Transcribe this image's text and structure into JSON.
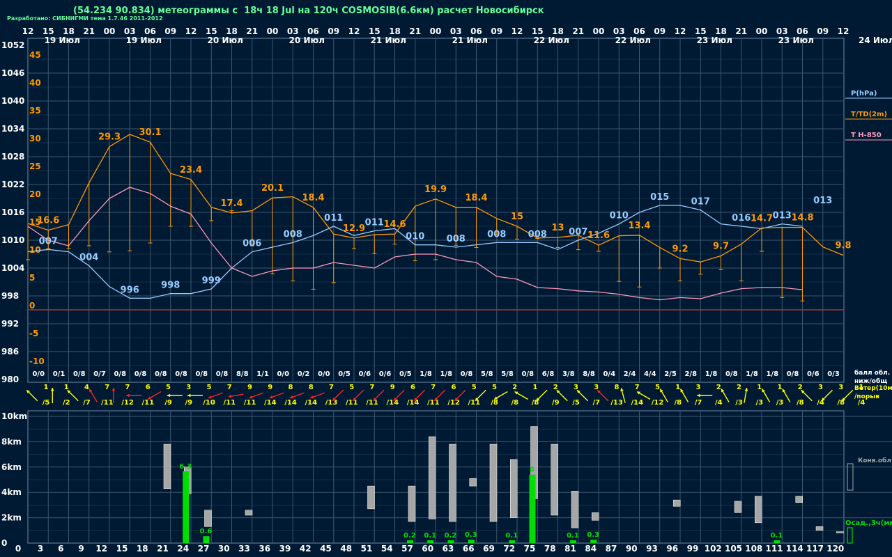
{
  "header": {
    "title": "(54.234 90.834) метеограммы с  18ч 18 Jul на 120ч COSMOSIB(6.6км) расчет Новосибирск",
    "developer": "Разработано: СИБНИГМИ тема 1.7.46 2011-2012"
  },
  "colors": {
    "background": "#001a33",
    "grid": "#3d5770",
    "pressure": "#99ccff",
    "temperature": "#ff9900",
    "t850": "#ff99bb",
    "zero_line": "#aa3333",
    "precip": "#00dd00",
    "convective_cloud": "#a6a6a6",
    "wind_calm": "#ffff00",
    "wind_strong": "#ff2222"
  },
  "time_axis": {
    "hours": [
      "12",
      "15",
      "18",
      "21",
      "00",
      "03",
      "06",
      "09",
      "12",
      "15",
      "18",
      "21",
      "00",
      "03",
      "06",
      "09",
      "12",
      "15",
      "18",
      "21",
      "00",
      "03",
      "06",
      "09",
      "12",
      "15",
      "18",
      "21",
      "00",
      "03",
      "06",
      "09",
      "12",
      "15",
      "18",
      "21",
      "00",
      "03",
      "06",
      "09",
      "12"
    ],
    "dates": [
      {
        "label": "19 Июл",
        "i": 1
      },
      {
        "label": "19 Июл",
        "i": 5
      },
      {
        "label": "20 Июл",
        "i": 9
      },
      {
        "label": "20 Июл",
        "i": 13
      },
      {
        "label": "21 Июл",
        "i": 17
      },
      {
        "label": "21 Июл",
        "i": 21
      },
      {
        "label": "22 Июл",
        "i": 25
      },
      {
        "label": "22 Июл",
        "i": 29
      },
      {
        "label": "23 Июл",
        "i": 33
      },
      {
        "label": "23 Июл",
        "i": 37
      }
    ],
    "right_date": "24 Июл",
    "lead_hours": [
      "3",
      "6",
      "9",
      "12",
      "15",
      "18",
      "21",
      "24",
      "27",
      "30",
      "33",
      "36",
      "39",
      "42",
      "45",
      "48",
      "51",
      "54",
      "57",
      "60",
      "63",
      "66",
      "69",
      "72",
      "75",
      "78",
      "81",
      "84",
      "87",
      "90",
      "93",
      "96",
      "99",
      "102",
      "105",
      "108",
      "111",
      "114",
      "117",
      "120"
    ],
    "lead_zero": "0"
  },
  "legend": {
    "pressure": "P(hPa)",
    "temperature": "T/TD(2m)",
    "t850": "T H-850",
    "cloud_label": "балл обл.",
    "cloud_sublabel": "ниж/общ",
    "wind_label": "Ветер(10м)",
    "wind_sublabel": "/порыв",
    "conv_label": "Конв.обл.",
    "precip_label": "Осад.,3ч(мм)"
  },
  "chart_data": {
    "type": "line",
    "pressure_axis": {
      "ticks": [
        "1052",
        "1046",
        "1040",
        "1034",
        "1028",
        "1022",
        "1016",
        "1010",
        "1004",
        "998",
        "992",
        "986",
        "980"
      ],
      "range": [
        980,
        1052
      ]
    },
    "temperature_axis": {
      "ticks": [
        "45",
        "40",
        "35",
        "30",
        "25",
        "20",
        "15",
        "10",
        "5",
        "0",
        "-5",
        "-10"
      ],
      "range": [
        -10,
        45
      ]
    },
    "series": [
      {
        "name": "P(hPa)",
        "values": [
          1007.5,
          1008,
          1007.5,
          1004.5,
          1000,
          997.5,
          997.5,
          998.5,
          998.5,
          999.5,
          1004,
          1007.5,
          1008.5,
          1009.5,
          1011,
          1013,
          1011,
          1012,
          1012.5,
          1009,
          1009,
          1008.5,
          1009,
          1009.5,
          1009.5,
          1009.5,
          1008,
          1010,
          1011.5,
          1013.5,
          1016,
          1017.5,
          1017.5,
          1016.5,
          1013.5,
          1013,
          1012.5,
          1013.5,
          1013
        ]
      },
      {
        "name": "T/TD(2m)",
        "values": [
          15.5,
          14.3,
          15.3,
          22.8,
          29.3,
          31.5,
          30.1,
          24.5,
          23.4,
          18.4,
          17.4,
          17.8,
          20.1,
          20.3,
          18.4,
          13.6,
          12.9,
          13.5,
          13.6,
          18.6,
          19.9,
          18.4,
          18.4,
          16.4,
          15,
          12.9,
          13,
          13.4,
          11.6,
          13.3,
          13.4,
          11.2,
          9.2,
          8.6,
          9.7,
          11.8,
          14.7,
          14.8,
          14.8,
          11.3,
          9.8
        ]
      },
      {
        "name": "TD",
        "values": [
          9,
          11,
          11,
          11.5,
          10.4,
          10.6,
          12,
          15,
          15,
          16,
          17.8,
          11.5,
          6.5,
          5.2,
          3.7,
          4.9,
          11,
          10.1,
          11.8,
          8.8,
          9,
          11.6,
          11.2,
          13.5,
          12.7,
          12.8,
          11.2,
          10.8,
          10.5,
          5.1,
          4.1,
          7.5,
          5.2,
          6.4,
          7.2,
          5.2,
          10.5,
          2.2,
          1.6
        ]
      },
      {
        "name": "T H-850",
        "values": [
          15,
          12.5,
          11.5,
          16,
          20,
          22,
          20.9,
          18.6,
          17.2,
          12,
          7.5,
          6,
          7,
          7.5,
          7.5,
          8.5,
          8,
          7.5,
          9.5,
          10,
          10,
          9,
          8.5,
          6,
          5.5,
          4,
          3.8,
          3.4,
          3.2,
          2.8,
          2.2,
          1.8,
          2.2,
          2,
          3,
          3.8,
          4,
          4,
          3.6
        ]
      }
    ],
    "temperature_labels": [
      {
        "i": 1,
        "v": "16.6"
      },
      {
        "i": 4,
        "v": "29.3"
      },
      {
        "i": 6,
        "v": "30.1"
      },
      {
        "i": 8,
        "v": "23.4"
      },
      {
        "i": 10,
        "v": "17.4"
      },
      {
        "i": 12,
        "v": "20.1"
      },
      {
        "i": 14,
        "v": "18.4"
      },
      {
        "i": 16,
        "v": "12.9"
      },
      {
        "i": 18,
        "v": "14.6"
      },
      {
        "i": 20,
        "v": "19.9"
      },
      {
        "i": 22,
        "v": "18.4"
      },
      {
        "i": 24,
        "v": "15"
      },
      {
        "i": 26,
        "v": "13"
      },
      {
        "i": 28,
        "v": "11.6"
      },
      {
        "i": 30,
        "v": "13.4"
      },
      {
        "i": 32,
        "v": "9.2"
      },
      {
        "i": 34,
        "v": "9.7"
      },
      {
        "i": 36,
        "v": "14.7"
      },
      {
        "i": 38,
        "v": "14.8"
      },
      {
        "i": 40,
        "v": "9.8"
      }
    ],
    "pressure_labels": [
      {
        "i": 1,
        "v": "007"
      },
      {
        "i": 3,
        "v": "004"
      },
      {
        "i": 5,
        "v": "996"
      },
      {
        "i": 7,
        "v": "998"
      },
      {
        "i": 9,
        "v": "999"
      },
      {
        "i": 11,
        "v": "006"
      },
      {
        "i": 13,
        "v": "008"
      },
      {
        "i": 15,
        "v": "011"
      },
      {
        "i": 17,
        "v": "011"
      },
      {
        "i": 19,
        "v": "010"
      },
      {
        "i": 21,
        "v": "008"
      },
      {
        "i": 23,
        "v": "008"
      },
      {
        "i": 25,
        "v": "008"
      },
      {
        "i": 27,
        "v": "007"
      },
      {
        "i": 29,
        "v": "010"
      },
      {
        "i": 31,
        "v": "015"
      },
      {
        "i": 33,
        "v": "017"
      },
      {
        "i": 35,
        "v": "016"
      },
      {
        "i": 37,
        "v": "013"
      },
      {
        "i": 39,
        "v": "013"
      }
    ],
    "cloud_cover": [
      "0/0",
      "0/1",
      "0/8",
      "0/7",
      "0/8",
      "0/8",
      "0/8",
      "0/8",
      "0/8",
      "0/8",
      "8/8",
      "1/1",
      "0/0",
      "0/2",
      "0/0",
      "0/5",
      "0/6",
      "0/6",
      "0/5",
      "1/8",
      "1/8",
      "0/8",
      "5/8",
      "5/8",
      "0/8",
      "6/8",
      "3/8",
      "8/8",
      "0/4",
      "2/4",
      "4/4",
      "2/5",
      "2/8",
      "1/8",
      "0/8",
      "1/8",
      "1/8",
      "0/8",
      "0/6",
      "0/3"
    ],
    "wind": [
      {
        "s": "1",
        "g": "/5",
        "dir": 315,
        "strong": false
      },
      {
        "s": "1",
        "g": "/2",
        "dir": 0,
        "strong": false
      },
      {
        "s": "4",
        "g": "/7",
        "dir": 315,
        "strong": false
      },
      {
        "s": "7",
        "g": "/11",
        "dir": 330,
        "strong": true
      },
      {
        "s": "7",
        "g": "/12",
        "dir": 0,
        "strong": true
      },
      {
        "s": "6",
        "g": "/11",
        "dir": 270,
        "strong": true
      },
      {
        "s": "5",
        "g": "/9",
        "dir": 240,
        "strong": true
      },
      {
        "s": "3",
        "g": "/9",
        "dir": 270,
        "strong": false
      },
      {
        "s": "5",
        "g": "/10",
        "dir": 270,
        "strong": false
      },
      {
        "s": "7",
        "g": "/11",
        "dir": 250,
        "strong": true
      },
      {
        "s": "9",
        "g": "/11",
        "dir": 260,
        "strong": true
      },
      {
        "s": "9",
        "g": "/14",
        "dir": 250,
        "strong": true
      },
      {
        "s": "8",
        "g": "/14",
        "dir": 250,
        "strong": true
      },
      {
        "s": "8",
        "g": "/14",
        "dir": 250,
        "strong": true
      },
      {
        "s": "7",
        "g": "/13",
        "dir": 250,
        "strong": true
      },
      {
        "s": "5",
        "g": "/11",
        "dir": 225,
        "strong": true
      },
      {
        "s": "7",
        "g": "/11",
        "dir": 225,
        "strong": true
      },
      {
        "s": "9",
        "g": "/14",
        "dir": 225,
        "strong": true
      },
      {
        "s": "6",
        "g": "/14",
        "dir": 225,
        "strong": true
      },
      {
        "s": "7",
        "g": "/11",
        "dir": 225,
        "strong": true
      },
      {
        "s": "6",
        "g": "/12",
        "dir": 225,
        "strong": true
      },
      {
        "s": "5",
        "g": "/11",
        "dir": 225,
        "strong": true
      },
      {
        "s": "5",
        "g": "/8",
        "dir": 225,
        "strong": false
      },
      {
        "s": "2",
        "g": "/8",
        "dir": 240,
        "strong": false
      },
      {
        "s": "1",
        "g": "/8",
        "dir": 300,
        "strong": false
      },
      {
        "s": "2",
        "g": "/9",
        "dir": 225,
        "strong": false
      },
      {
        "s": "3",
        "g": "/5",
        "dir": 315,
        "strong": false
      },
      {
        "s": "3",
        "g": "/7",
        "dir": 315,
        "strong": false
      },
      {
        "s": "8",
        "g": "/13",
        "dir": 315,
        "strong": true
      },
      {
        "s": "7",
        "g": "/14",
        "dir": 345,
        "strong": false
      },
      {
        "s": "5",
        "g": "/12",
        "dir": 300,
        "strong": false
      },
      {
        "s": "1",
        "g": "/8",
        "dir": 330,
        "strong": false
      },
      {
        "s": "3",
        "g": "/7",
        "dir": 330,
        "strong": false
      },
      {
        "s": "2",
        "g": "/4",
        "dir": 270,
        "strong": false
      },
      {
        "s": "2",
        "g": "/3",
        "dir": 330,
        "strong": false
      },
      {
        "s": "1",
        "g": "/3",
        "dir": 10,
        "strong": false
      },
      {
        "s": "1",
        "g": "/3",
        "dir": 330,
        "strong": false
      },
      {
        "s": "2",
        "g": "/8",
        "dir": 330,
        "strong": false
      },
      {
        "s": "3",
        "g": "/4",
        "dir": 315,
        "strong": false
      },
      {
        "s": "3",
        "g": "/8",
        "dir": 225,
        "strong": false
      },
      {
        "s": "1",
        "g": "/4",
        "dir": 225,
        "strong": false
      }
    ],
    "height_axis": {
      "ticks": [
        "10km",
        "8km",
        "6km",
        "4km",
        "2km",
        "0"
      ],
      "range": [
        0,
        10
      ]
    },
    "convective_clouds": [
      {
        "i": 8,
        "bottom": 4.3,
        "top": 7.8
      },
      {
        "i": 9,
        "bottom": 3.9,
        "top": 6
      },
      {
        "i": 10,
        "bottom": 1.3,
        "top": 2.6
      },
      {
        "i": 12,
        "bottom": 2.2,
        "top": 2.6
      },
      {
        "i": 18,
        "bottom": 2.7,
        "top": 4.5
      },
      {
        "i": 20,
        "bottom": 1.7,
        "top": 4.5
      },
      {
        "i": 21,
        "bottom": 1.9,
        "top": 8.4
      },
      {
        "i": 22,
        "bottom": 1.7,
        "top": 7.8
      },
      {
        "i": 23,
        "bottom": 4.5,
        "top": 5.1
      },
      {
        "i": 24,
        "bottom": 1.7,
        "top": 7.8
      },
      {
        "i": 25,
        "bottom": 2,
        "top": 6.6
      },
      {
        "i": 26,
        "bottom": 3.5,
        "top": 9.2
      },
      {
        "i": 27,
        "bottom": 2.2,
        "top": 7.8
      },
      {
        "i": 28,
        "bottom": 1.2,
        "top": 4.1
      },
      {
        "i": 29,
        "bottom": 1.8,
        "top": 2.4
      },
      {
        "i": 33,
        "bottom": 2.9,
        "top": 3.4
      },
      {
        "i": 36,
        "bottom": 2.4,
        "top": 3.3
      },
      {
        "i": 37,
        "bottom": 1.6,
        "top": 3.7
      },
      {
        "i": 39,
        "bottom": 3.2,
        "top": 3.7
      },
      {
        "i": 40,
        "bottom": 1.0,
        "top": 1.3
      },
      {
        "i": 41,
        "bottom": 0.8,
        "top": 0.9
      }
    ],
    "precipitation": [
      {
        "i": 9,
        "v": 6.3
      },
      {
        "i": 10,
        "v": 0.6
      },
      {
        "i": 20,
        "v": 0.2
      },
      {
        "i": 21,
        "v": 0.1
      },
      {
        "i": 22,
        "v": 0.2
      },
      {
        "i": 23,
        "v": 0.3
      },
      {
        "i": 25,
        "v": 0.1
      },
      {
        "i": 26,
        "v": 6
      },
      {
        "i": 28,
        "v": 0.1
      },
      {
        "i": 29,
        "v": 0.3
      },
      {
        "i": 38,
        "v": 0.1
      }
    ]
  }
}
